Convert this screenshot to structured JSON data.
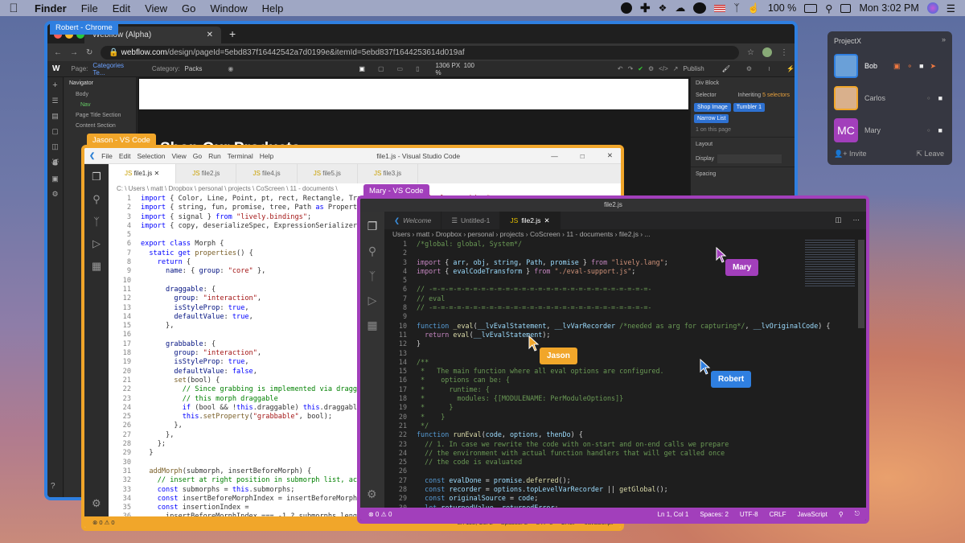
{
  "menubar": {
    "app": "Finder",
    "items": [
      "File",
      "Edit",
      "View",
      "Go",
      "Window",
      "Help"
    ],
    "battery": "100 %",
    "clock": "Mon 3:02 PM"
  },
  "chrome": {
    "tag": "Robert - Chrome",
    "tab_title": "Webflow (Alpha)",
    "url_host": "webflow.com",
    "url_path": "/design/pageId=5ebd837f16442542a7d0199e&itemId=5ebd837f1644253614d019af",
    "wf": {
      "page_label": "Page:",
      "page_value": "Categories Te...",
      "category_label": "Category:",
      "category_value": "Packs",
      "size": "1306",
      "size_unit": "PX",
      "zoom": "100",
      "zoom_unit": "%",
      "publish": "Publish",
      "navigator": "Navigator",
      "tree": [
        "Body",
        "Nav",
        "Page Title Section",
        "Content Section"
      ],
      "heading": "Shop Our Products",
      "right": {
        "element": "Div Block",
        "selector": "Selector",
        "inheriting": "Inheriting",
        "inherit_count": "5 selectors",
        "chips": [
          "Shop Image",
          "Tumbler 1",
          "Narrow List"
        ],
        "on_page": "1 on this page",
        "layout": "Layout",
        "display": "Display",
        "spacing": "Spacing"
      }
    }
  },
  "vsj": {
    "tag": "Jason - VS Code",
    "menu": [
      "File",
      "Edit",
      "Selection",
      "View",
      "Go",
      "Run",
      "Terminal",
      "Help"
    ],
    "title": "file1.js - Visual Studio Code",
    "tabs": [
      "file1.js",
      "file2.js",
      "file4.js",
      "file5.js",
      "file3.js"
    ],
    "crumb": "C: \\ Users \\ matt \\ Dropbox \\ personal \\ projects \\ CoScreen \\ 11 - documents \\",
    "status": [
      "⊗ 0 ⚠ 0",
      "Ln 118, Col 2",
      "Spaces: 2",
      "UTF-8",
      "CRLF",
      "JavaScript"
    ]
  },
  "vsm": {
    "tag": "Mary - VS Code",
    "title": "file2.js",
    "tabs": [
      "Welcome",
      "Untitled-1",
      "file2.js"
    ],
    "crumb": "Users › matt › Dropbox › personal › projects › CoScreen › 11 - documents › file2.js › ...",
    "status_left": "⊗ 0 ⚠ 0",
    "status_right": [
      "Ln 1, Col 1",
      "Spaces: 2",
      "UTF-8",
      "CRLF",
      "JavaScript"
    ]
  },
  "projectx": {
    "title": "ProjectX",
    "users": [
      "Bob",
      "Carlos",
      "Mary"
    ],
    "mary_initials": "MC",
    "invite": "Invite",
    "leave": "Leave"
  },
  "cursors": {
    "mary": "Mary",
    "jason": "Jason",
    "robert": "Robert"
  },
  "colors": {
    "robert": "#2f7fe0",
    "jason": "#f1a62a",
    "mary": "#a23fbb"
  }
}
